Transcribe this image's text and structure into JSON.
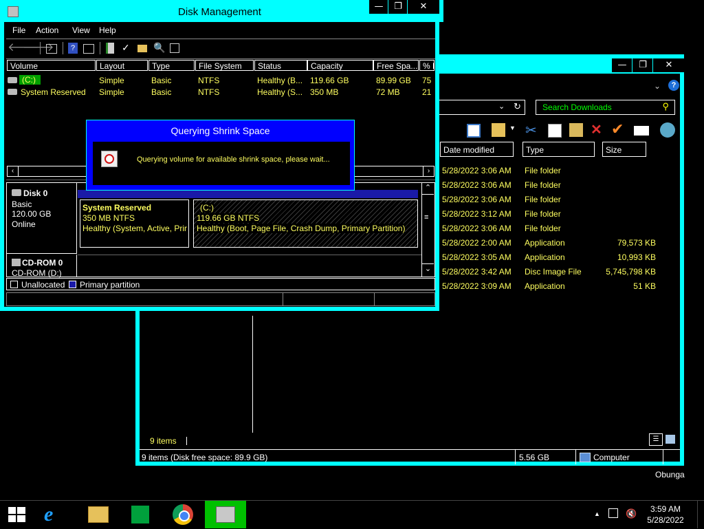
{
  "explorer": {
    "search_placeholder": "Search Downloads",
    "columns": [
      "Date modified",
      "Type",
      "Size"
    ],
    "files": [
      {
        "date": "5/28/2022 3:06 AM",
        "type": "File folder",
        "size": ""
      },
      {
        "date": "5/28/2022 3:06 AM",
        "type": "File folder",
        "size": ""
      },
      {
        "date": "5/28/2022 3:06 AM",
        "type": "File folder",
        "size": ""
      },
      {
        "date": "5/28/2022 3:12 AM",
        "type": "File folder",
        "size": ""
      },
      {
        "date": "5/28/2022 3:06 AM",
        "type": "File folder",
        "size": ""
      },
      {
        "date": "5/28/2022 2:00 AM",
        "type": "Application",
        "size": "79,573 KB"
      },
      {
        "date": "5/28/2022 3:05 AM",
        "type": "Application",
        "size": "10,993 KB"
      },
      {
        "date": "5/28/2022 3:42 AM",
        "type": "Disc Image File",
        "size": "5,745,798 KB"
      },
      {
        "date": "5/28/2022 3:09 AM",
        "type": "Application",
        "size": "51 KB"
      }
    ],
    "item_count": "9 items",
    "status_left": "9 items (Disk free space: 89.9 GB)",
    "status_size": "5.56 GB",
    "status_location": "Computer"
  },
  "diskmgmt": {
    "title": "Disk Management",
    "menu": [
      "File",
      "Action",
      "View",
      "Help"
    ],
    "columns": [
      "Volume",
      "Layout",
      "Type",
      "File System",
      "Status",
      "Capacity",
      "Free Spa...",
      "% F"
    ],
    "volumes": [
      {
        "volume": "(C:)",
        "layout": "Simple",
        "type": "Basic",
        "fs": "NTFS",
        "status": "Healthy (B...",
        "capacity": "119.66 GB",
        "free": "89.99 GB",
        "pct": "75"
      },
      {
        "volume": "System Reserved",
        "layout": "Simple",
        "type": "Basic",
        "fs": "NTFS",
        "status": "Healthy (S...",
        "capacity": "350 MB",
        "free": "72 MB",
        "pct": "21"
      }
    ],
    "disk0": {
      "name": "Disk 0",
      "type": "Basic",
      "size": "120.00 GB",
      "state": "Online"
    },
    "part_sys": {
      "name": "System Reserved",
      "size": "350 MB NTFS",
      "status": "Healthy (System, Active, Prir"
    },
    "part_c": {
      "name": "(C:)",
      "size": "119.66 GB NTFS",
      "status": "Healthy (Boot, Page File, Crash Dump, Primary Partition)"
    },
    "cdrom": {
      "name": "CD-ROM 0",
      "drive": "CD-ROM (D:)"
    },
    "legend": [
      "Unallocated",
      "Primary partition"
    ]
  },
  "dialog": {
    "title": "Querying Shrink Space",
    "message": "Querying volume for available shrink space, please wait..."
  },
  "desktop": {
    "username": "Obunga"
  },
  "taskbar": {
    "time": "3:59 AM",
    "date": "5/28/2022"
  },
  "colors": {
    "accent": "#00ffff",
    "dialog_blue": "#0000ff",
    "text_yellow": "#ffff60",
    "chrome_green": "#00a000"
  }
}
